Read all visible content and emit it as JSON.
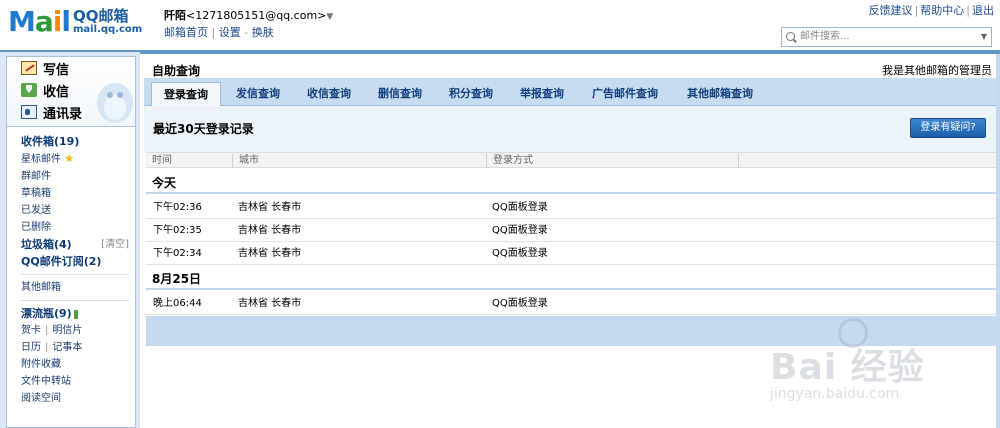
{
  "header": {
    "logo_text_m": "M",
    "logo_text_a": "a",
    "logo_text_i": "i",
    "logo_text_l": "l",
    "logo_qq": "QQ邮箱",
    "logo_domain": "mail.qq.com",
    "user_name": "阡陌",
    "user_email": "<1271805151@qq.com>",
    "home_link": "邮箱首页",
    "settings_link": "设置",
    "switch_link": "换肤",
    "top_links": [
      "反馈建议",
      "帮助中心",
      "退出"
    ],
    "search_placeholder": "邮件搜索..."
  },
  "sidebar": {
    "quick_actions": [
      "写信",
      "收信",
      "通讯录"
    ],
    "folders": [
      {
        "label": "收件箱(19)",
        "bold": true
      },
      {
        "label": "星标邮件",
        "bold": false
      },
      {
        "label": "群邮件",
        "bold": false
      },
      {
        "label": "草稿箱",
        "bold": false
      },
      {
        "label": "已发送",
        "bold": false
      },
      {
        "label": "已删除",
        "bold": false
      },
      {
        "label": "垃圾箱(4)",
        "bold": true
      },
      {
        "label": "QQ邮件订阅(2)",
        "bold": true
      }
    ],
    "clear_label": "[清空]",
    "other_mail": "其他邮箱",
    "drift_bottle": "漂流瓶(9)",
    "apps": [
      {
        "a": "贺卡",
        "b": "明信片"
      },
      {
        "a": "日历",
        "b": "记事本"
      }
    ],
    "extra": [
      "附件收藏",
      "文件中转站",
      "阅读空间"
    ]
  },
  "main": {
    "title": "自助查询",
    "admin_text": "我是其他邮箱的管理员",
    "tabs": [
      "登录查询",
      "发信查询",
      "收信查询",
      "删信查询",
      "积分查询",
      "举报查询",
      "广告邮件查询",
      "其他邮箱查询"
    ],
    "active_tab": "登录查询",
    "section_title": "最近30天登录记录",
    "question_button": "登录有疑问?",
    "columns": [
      "时间",
      "城市",
      "登录方式"
    ],
    "groups": [
      {
        "label": "今天",
        "rows": [
          {
            "time": "下午02:36",
            "city": "吉林省 长春市",
            "method": "QQ面板登录"
          },
          {
            "time": "下午02:35",
            "city": "吉林省 长春市",
            "method": "QQ面板登录"
          },
          {
            "time": "下午02:34",
            "city": "吉林省 长春市",
            "method": "QQ面板登录"
          }
        ]
      },
      {
        "label": "8月25日",
        "rows": [
          {
            "time": "晚上06:44",
            "city": "吉林省 长春市",
            "method": "QQ面板登录"
          }
        ]
      }
    ]
  },
  "watermark": {
    "brand": "Bai 经验",
    "url": "jingyan.baidu.com"
  },
  "colors": {
    "frame": "#5f94c8",
    "tabbar": "#c8dcf1",
    "link": "#1b4a8f",
    "button": "#1d5ea9"
  }
}
